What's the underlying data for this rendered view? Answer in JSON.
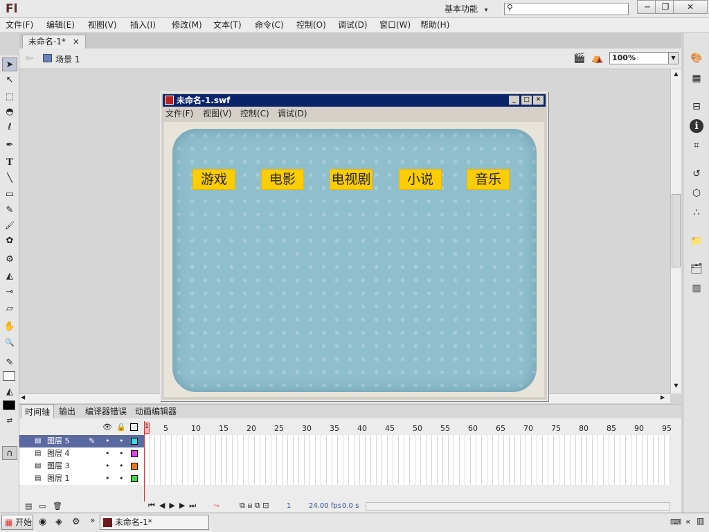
{
  "app": {
    "logo": "Fl",
    "workspace": "基本功能",
    "workspace_arrow": "▾"
  },
  "window_controls": {
    "minimize": "─",
    "restore": "❐",
    "close": "✕"
  },
  "menu": [
    "文件(F)",
    "编辑(E)",
    "视图(V)",
    "插入(I)",
    "修改(M)",
    "文本(T)",
    "命令(C)",
    "控制(O)",
    "调试(D)",
    "窗口(W)",
    "帮助(H)"
  ],
  "document_tab": {
    "label": "未命名-1*",
    "close": "×"
  },
  "scene": {
    "back": "⇦",
    "label": "场景 1",
    "zoom": "100%"
  },
  "tools": [
    "selection-tool",
    "subselection-tool",
    "free-transform-tool",
    "3d-rotation-tool",
    "lasso-tool",
    "pen-tool",
    "text-tool",
    "line-tool",
    "rectangle-tool",
    "pencil-tool",
    "brush-tool",
    "deco-tool",
    "bone-tool",
    "paint-bucket-tool",
    "eyedropper-tool",
    "eraser-tool",
    "hand-tool",
    "zoom-tool"
  ],
  "tool_glyphs": [
    "➤",
    "↖",
    "⬚",
    "◓",
    "ℓ",
    "✒",
    "T",
    "╲",
    "▭",
    "✎",
    "🖌",
    "✿",
    "⚙",
    "◭",
    "⊸",
    "▱",
    "✋",
    "🔍"
  ],
  "right_panel_icons": [
    "palette-icon",
    "swatches-icon",
    "align-icon",
    "info-icon",
    "transform-icon",
    "history-icon",
    "components-icon",
    "motion-presets-icon",
    "library-icon",
    "project-icon",
    "strings-icon"
  ],
  "right_panel_glyphs": [
    "🎨",
    "▦",
    "⊟",
    "ℹ",
    "⌗",
    "↺",
    "⬡",
    "∴",
    "📁",
    "🗂",
    "▥"
  ],
  "swf": {
    "title": "未命名-1.swf",
    "menu": [
      "文件(F)",
      "视图(V)",
      "控制(C)",
      "调试(D)"
    ],
    "nav_buttons": [
      "游戏",
      "电影",
      "电视剧",
      "小说",
      "音乐"
    ]
  },
  "timeline": {
    "tabs": [
      "时间轴",
      "输出",
      "编译器错误",
      "动画编辑器"
    ],
    "frame_numbers": [
      "1",
      "5",
      "10",
      "15",
      "20",
      "25",
      "30",
      "35",
      "40",
      "45",
      "50",
      "55",
      "60",
      "65",
      "70",
      "75",
      "80",
      "85",
      "90",
      "95"
    ],
    "layers": [
      {
        "name": "图层 5",
        "color": "#33e0e8",
        "active": true
      },
      {
        "name": "图层 4",
        "color": "#e040e8"
      },
      {
        "name": "图层 3",
        "color": "#f07810"
      },
      {
        "name": "图层 1",
        "color": "#40d840"
      }
    ],
    "status": {
      "frame": "1",
      "fps": "24.00",
      "fps_unit": "fps",
      "time": "0.0",
      "time_unit": "s"
    }
  },
  "taskbar": {
    "start": "开始",
    "task": "未命名-1*",
    "expand": "»",
    "collapse": "«"
  },
  "colors": {
    "nav_button": "#fccc04",
    "board": "#8fbfcd",
    "titlebar_active": "#0a246a",
    "playhead": "#e03030"
  }
}
